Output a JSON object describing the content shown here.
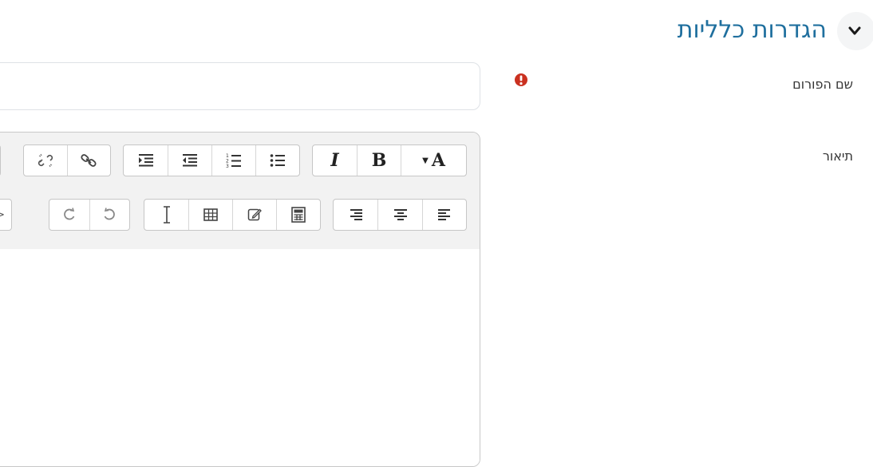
{
  "section": {
    "title": "הגדרות כלליות",
    "toggle_icon": "chevron-down-icon"
  },
  "fields": {
    "forum_name_label": "שם הפורום",
    "forum_name_value": "",
    "required_icon": "exclamation-circle-icon",
    "required_color": "#ca3120",
    "description_label": "תיאור"
  },
  "toolbar": {
    "row1": {
      "italic_label": "I",
      "bold_label": "B",
      "font_color_label": "A",
      "icons": [
        "link-icon",
        "unlink-icon",
        "indent-icon",
        "outdent-icon",
        "numbered-list-icon",
        "bullet-list-icon",
        "italic-icon",
        "bold-icon",
        "font-color-icon"
      ]
    },
    "row2": {
      "html_label": "/>",
      "icons": [
        "html-icon",
        "redo-icon",
        "undo-icon",
        "text-cursor-icon",
        "table-icon",
        "edit-icon",
        "calculator-icon",
        "align-right-icon",
        "align-center-icon",
        "align-left-icon"
      ]
    }
  },
  "colors": {
    "title": "#1f6f9e",
    "required": "#ca3120",
    "toolbar_bg": "#f2f2f2",
    "border": "#c8c8c8"
  }
}
